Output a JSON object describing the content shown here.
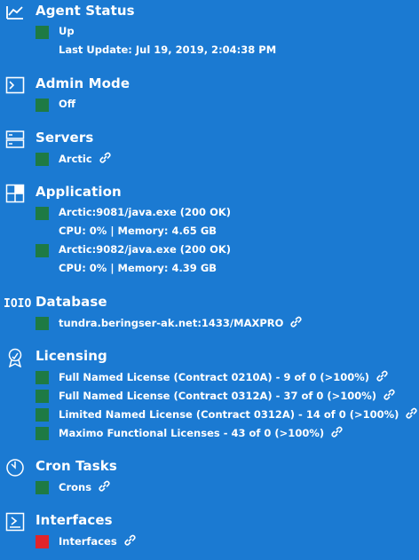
{
  "colors": {
    "background": "#1b7ad2",
    "ok": "#1e7a44",
    "error": "#e0242a",
    "text": "#ffffff"
  },
  "agent_status": {
    "title": "Agent Status",
    "icon": "line-chart-icon",
    "status": "Up",
    "last_update": "Last Update: Jul 19, 2019, 2:04:38 PM"
  },
  "admin_mode": {
    "title": "Admin Mode",
    "icon": "terminal-icon",
    "status": "Off"
  },
  "servers": {
    "title": "Servers",
    "icon": "server-icon",
    "items": [
      {
        "label": "Arctic",
        "status": "ok"
      }
    ]
  },
  "application": {
    "title": "Application",
    "icon": "application-grid-icon",
    "items": [
      {
        "label": "Arctic:9081/java.exe (200 OK)",
        "detail": "CPU: 0% | Memory: 4.65 GB",
        "status": "ok"
      },
      {
        "label": "Arctic:9082/java.exe (200 OK)",
        "detail": "CPU: 0% | Memory: 4.39 GB",
        "status": "ok"
      }
    ]
  },
  "database": {
    "title": "Database",
    "icon": "database-binary-icon",
    "icon_text": "IOIO",
    "items": [
      {
        "label": "tundra.beringser-ak.net:1433/MAXPRO",
        "status": "ok"
      }
    ]
  },
  "licensing": {
    "title": "Licensing",
    "icon": "award-ribbon-icon",
    "items": [
      {
        "label": "Full Named License (Contract 0210A) - 9 of 0 (>100%)",
        "status": "ok"
      },
      {
        "label": "Full Named License (Contract 0312A) - 37 of 0 (>100%)",
        "status": "ok"
      },
      {
        "label": "Limited Named License (Contract 0312A) - 14 of 0 (>100%)",
        "status": "ok"
      },
      {
        "label": "Maximo Functional Licenses - 43 of 0 (>100%)",
        "status": "ok"
      }
    ]
  },
  "cron_tasks": {
    "title": "Cron Tasks",
    "icon": "clock-icon",
    "items": [
      {
        "label": "Crons",
        "status": "ok"
      }
    ]
  },
  "interfaces": {
    "title": "Interfaces",
    "icon": "interface-arrow-icon",
    "items": [
      {
        "label": "Interfaces",
        "status": "error"
      }
    ]
  }
}
